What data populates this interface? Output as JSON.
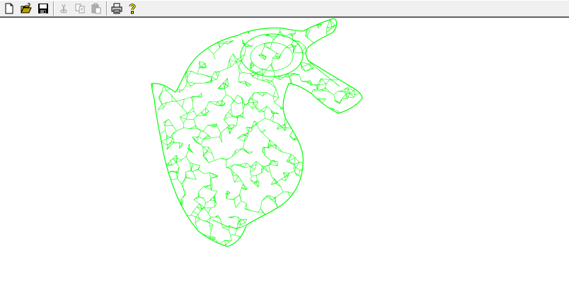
{
  "toolbar": {
    "buttons": [
      {
        "name": "new-button",
        "icon": "new-document-icon",
        "enabled": true
      },
      {
        "name": "open-button",
        "icon": "open-folder-icon",
        "enabled": true
      },
      {
        "name": "save-button",
        "icon": "floppy-disk-icon",
        "enabled": true
      },
      {
        "name": "cut-button",
        "icon": "scissors-icon",
        "enabled": false
      },
      {
        "name": "copy-button",
        "icon": "copy-icon",
        "enabled": false
      },
      {
        "name": "paste-button",
        "icon": "clipboard-icon",
        "enabled": false
      },
      {
        "name": "print-button",
        "icon": "printer-icon",
        "enabled": true
      },
      {
        "name": "help-button",
        "icon": "help-question-icon",
        "enabled": true
      }
    ]
  },
  "viewport": {
    "background": "#ffffff",
    "model": "bunny",
    "render_mode": "wireframe",
    "mesh_color": "#00ff00"
  }
}
